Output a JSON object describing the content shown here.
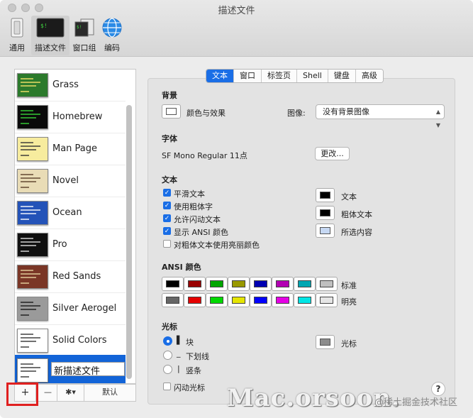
{
  "window": {
    "title": "描述文件"
  },
  "toolbar": [
    {
      "label": "通用",
      "icon": "switch-icon"
    },
    {
      "label": "描述文件",
      "icon": "terminal-profile-icon",
      "selected": true
    },
    {
      "label": "窗口组",
      "icon": "window-group-icon"
    },
    {
      "label": "编码",
      "icon": "globe-icon"
    }
  ],
  "profiles": [
    {
      "name": "Grass",
      "bg": "#2c7a2c",
      "text": "#f5e26a"
    },
    {
      "name": "Homebrew",
      "bg": "#0a0a0a",
      "text": "#37d437"
    },
    {
      "name": "Man Page",
      "bg": "#f7ec9e",
      "text": "#333333"
    },
    {
      "name": "Novel",
      "bg": "#e9dcb6",
      "text": "#5a3f2a"
    },
    {
      "name": "Ocean",
      "bg": "#2453b8",
      "text": "#ffffff"
    },
    {
      "name": "Pro",
      "bg": "#101010",
      "text": "#e0e0e0"
    },
    {
      "name": "Red Sands",
      "bg": "#7a3626",
      "text": "#e8d3a0"
    },
    {
      "name": "Silver Aerogel",
      "bg": "#9a9a9a",
      "text": "#1a1a1a"
    },
    {
      "name": "Solid Colors",
      "bg": "#ffffff",
      "text": "#333333"
    },
    {
      "name": "新描述文件",
      "bg": "#ffffff",
      "text": "#333333",
      "selected": true,
      "editing": true
    }
  ],
  "list_buttons": {
    "add": "+",
    "remove": "—",
    "gear": "✱▾",
    "default": "默认"
  },
  "tabs": [
    {
      "label": "文本",
      "active": true
    },
    {
      "label": "窗口"
    },
    {
      "label": "标签页"
    },
    {
      "label": "Shell"
    },
    {
      "label": "键盘"
    },
    {
      "label": "高级"
    }
  ],
  "background": {
    "section": "背景",
    "color_effect_label": "颜色与效果",
    "image_label": "图像:",
    "image_value": "没有背景图像"
  },
  "font": {
    "section": "字体",
    "value": "SF Mono Regular 11点",
    "change_button": "更改..."
  },
  "text": {
    "section": "文本",
    "options": [
      {
        "label": "平滑文本",
        "checked": true
      },
      {
        "label": "使用粗体字",
        "checked": true
      },
      {
        "label": "允许闪动文本",
        "checked": true
      },
      {
        "label": "显示 ANSI 颜色",
        "checked": true
      },
      {
        "label": "对粗体文本使用亮丽颜色",
        "checked": false
      }
    ],
    "colors": [
      {
        "label": "文本",
        "color": "#000000"
      },
      {
        "label": "粗体文本",
        "color": "#000000"
      },
      {
        "label": "所选内容",
        "color": "#c6d8f3"
      }
    ]
  },
  "ansi": {
    "section": "ANSI 颜色",
    "normal_label": "标准",
    "bright_label": "明亮",
    "normal": [
      "#000000",
      "#990000",
      "#00a600",
      "#999900",
      "#0000b2",
      "#b200b2",
      "#00a6b2",
      "#bfbfbf"
    ],
    "bright": [
      "#666666",
      "#e50000",
      "#00d900",
      "#e5e500",
      "#0000ff",
      "#e500e5",
      "#00e5e5",
      "#e5e5e5"
    ]
  },
  "cursor": {
    "section": "光标",
    "styles": [
      {
        "glyph": "▌",
        "label": "块",
        "selected": true
      },
      {
        "glyph": "_",
        "label": "下划线",
        "selected": false
      },
      {
        "glyph": "|",
        "label": "竖条",
        "selected": false
      }
    ],
    "blink_label": "闪动光标",
    "blink_checked": false,
    "color_label": "光标",
    "color": "#8c8c8c"
  },
  "help": "?",
  "watermark": {
    "text": "Mac.orsoon.",
    "sub": "@稀土掘金技术社区"
  }
}
